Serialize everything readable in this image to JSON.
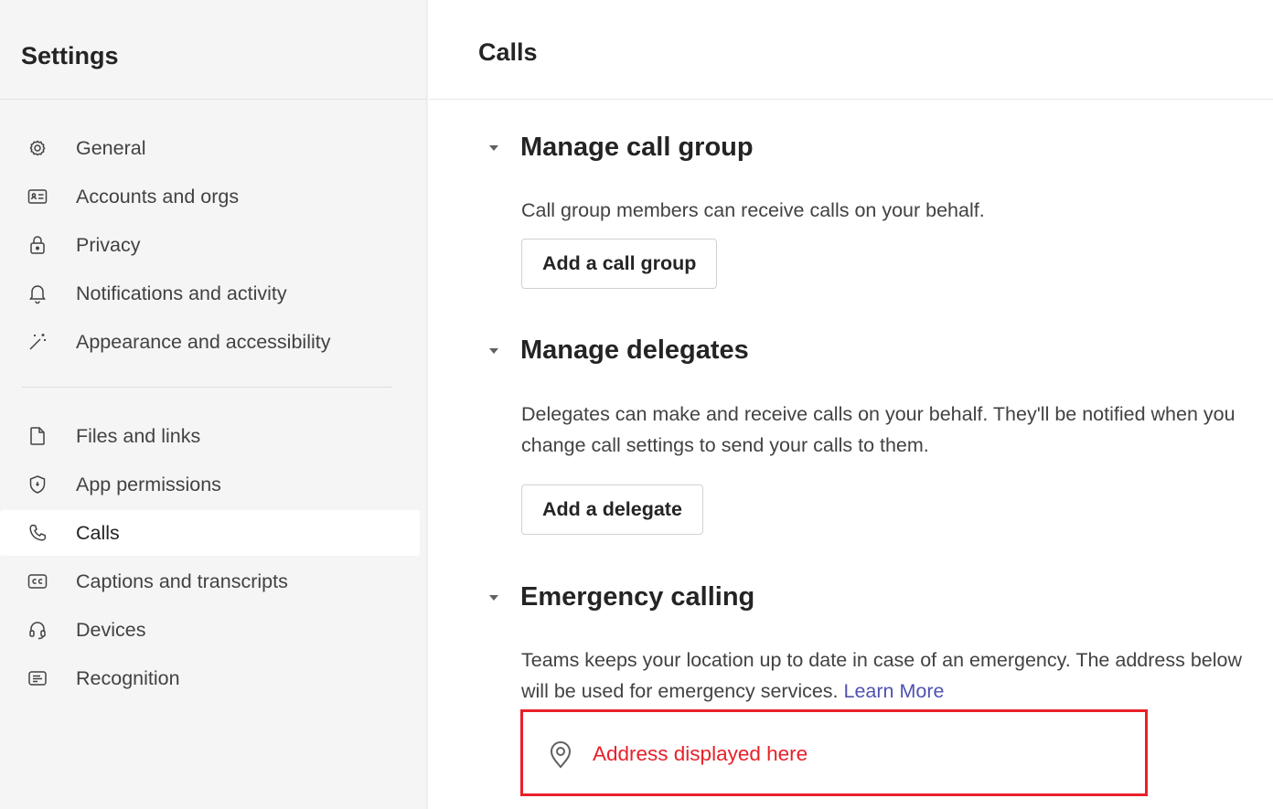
{
  "sidebar": {
    "title": "Settings",
    "items": [
      {
        "label": "General",
        "icon": "gear-icon"
      },
      {
        "label": "Accounts and orgs",
        "icon": "id-card-icon"
      },
      {
        "label": "Privacy",
        "icon": "lock-icon"
      },
      {
        "label": "Notifications and activity",
        "icon": "bell-icon"
      },
      {
        "label": "Appearance and accessibility",
        "icon": "magic-wand-icon"
      },
      {
        "label": "Files and links",
        "icon": "document-icon"
      },
      {
        "label": "App permissions",
        "icon": "shield-icon"
      },
      {
        "label": "Calls",
        "icon": "phone-icon",
        "selected": true
      },
      {
        "label": "Captions and transcripts",
        "icon": "closed-caption-icon"
      },
      {
        "label": "Devices",
        "icon": "headset-icon"
      },
      {
        "label": "Recognition",
        "icon": "recognition-icon"
      }
    ]
  },
  "main": {
    "title": "Calls",
    "sections": [
      {
        "title": "Manage call group",
        "description": "Call group members can receive calls on your behalf.",
        "button": "Add a call group"
      },
      {
        "title": "Manage delegates",
        "description": "Delegates can make and receive calls on your behalf. They'll be notified when you change call settings to send your calls to them.",
        "button": "Add a delegate"
      },
      {
        "title": "Emergency calling",
        "description": "Teams keeps your location up to date in case of an emergency. The address below will be used for emergency services.",
        "link": "Learn More",
        "address": "Address displayed here"
      }
    ]
  },
  "colors": {
    "accent": "#4f52b2",
    "highlight_border": "#e8202a",
    "sidebar_bg": "#f5f5f5"
  }
}
